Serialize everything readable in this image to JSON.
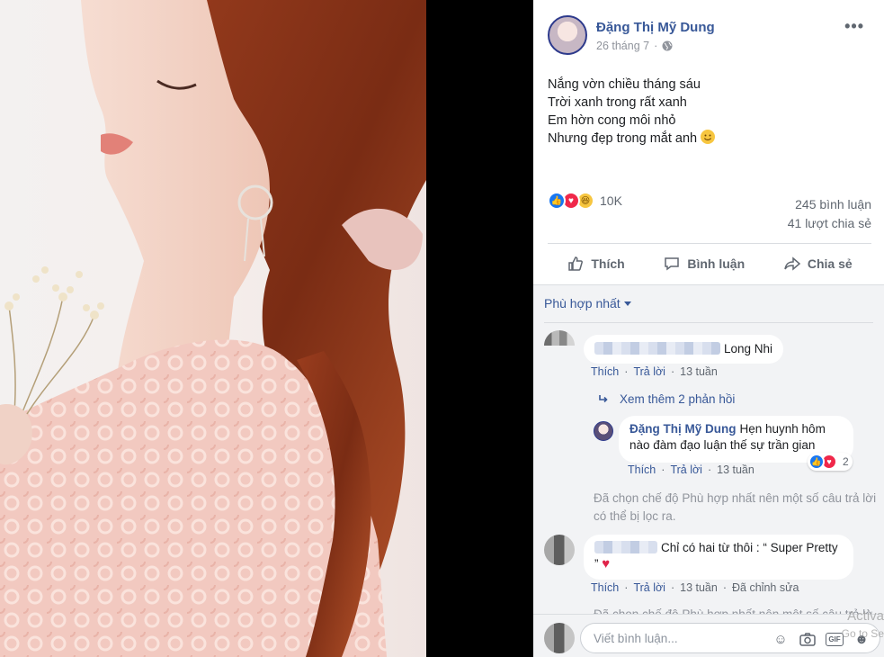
{
  "post": {
    "author": "Đặng Thị Mỹ Dung",
    "date": "26 tháng 7",
    "lines": [
      "Nắng vờn chiều tháng sáu",
      "Trời xanh trong rất xanh",
      "Em hờn cong môi nhỏ",
      "Nhưng đẹp trong mắt anh"
    ],
    "reaction_count": "10K",
    "comments_count": "245 bình luận",
    "shares_count": "41 lượt chia sẻ"
  },
  "actions": {
    "like": "Thích",
    "comment": "Bình luận",
    "share": "Chia sẻ"
  },
  "filter_label": "Phù hợp nhất",
  "comments": [
    {
      "name": "Long Nhi",
      "like": "Thích",
      "reply": "Trả lời",
      "time": "13 tuần",
      "more_replies": "Xem thêm 2 phản hồi",
      "reply_item": {
        "name": "Đặng Thị Mỹ Dung",
        "text": "Hẹn huynh hôm nào đàm đạo luận thế sự trần gian",
        "like": "Thích",
        "reply": "Trả lời",
        "time": "13 tuần",
        "reaction_count": "2"
      }
    },
    {
      "text": "Chỉ có hai từ thôi : “ Super Pretty ”",
      "like": "Thích",
      "reply": "Trả lời",
      "time": "13 tuần",
      "edited": "Đã chỉnh sửa"
    }
  ],
  "filter_note": "Đã chọn chế độ Phù hợp nhất nên một số câu trả lời có thể bị lọc ra.",
  "write_placeholder": "Viết bình luận...",
  "watermark": {
    "line1": "Activa",
    "line2": "Go to Se"
  },
  "colors": {
    "link": "#385898",
    "like_blue": "#1877f2",
    "love_red": "#f0284a",
    "haha_yellow": "#f7c640"
  },
  "icons": [
    "globe-icon",
    "more-icon",
    "like-icon",
    "comment-icon",
    "share-icon",
    "reply-arrow-icon",
    "emoji-icon",
    "camera-icon",
    "gif-icon",
    "sticker-icon"
  ]
}
